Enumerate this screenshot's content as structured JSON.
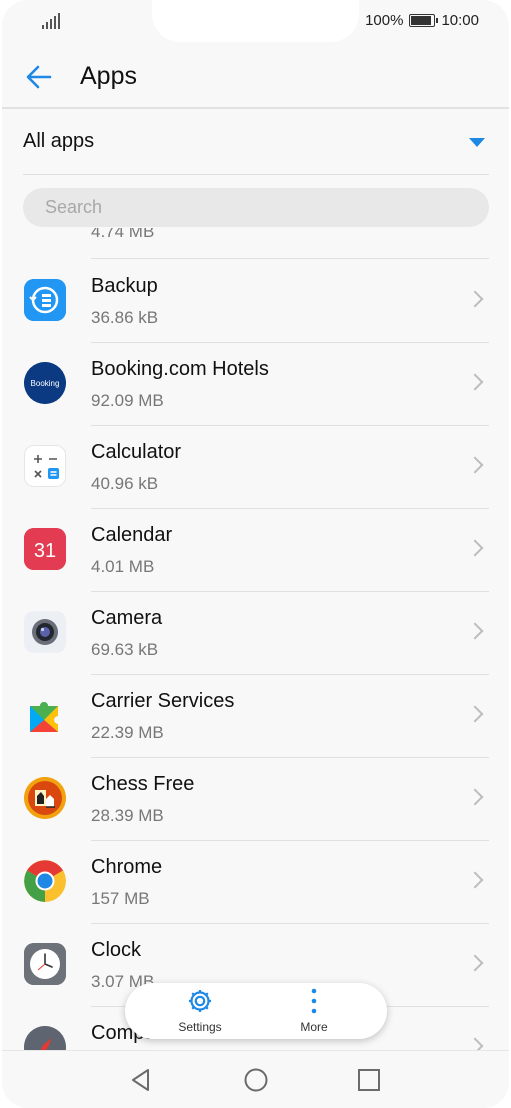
{
  "status_bar": {
    "battery": "100%",
    "time": "10:00"
  },
  "header": {
    "title": "Apps",
    "back_icon": "arrow-left-icon"
  },
  "filter": {
    "label": "All apps",
    "icon": "dropdown-triangle-icon"
  },
  "search": {
    "placeholder": "Search",
    "value": ""
  },
  "list": {
    "partial_size": "4.74 MB",
    "apps": [
      {
        "name": "Backup",
        "size": "36.86 kB",
        "icon": "backup-icon"
      },
      {
        "name": "Booking.com Hotels",
        "size": "92.09 MB",
        "icon": "booking-icon",
        "icon_text": "Booking"
      },
      {
        "name": "Calculator",
        "size": "40.96 kB",
        "icon": "calculator-icon"
      },
      {
        "name": "Calendar",
        "size": "4.01 MB",
        "icon": "calendar-icon",
        "icon_text": "31"
      },
      {
        "name": "Camera",
        "size": "69.63 kB",
        "icon": "camera-icon"
      },
      {
        "name": "Carrier Services",
        "size": "22.39 MB",
        "icon": "carrier-services-icon"
      },
      {
        "name": "Chess Free",
        "size": "28.39 MB",
        "icon": "chess-icon"
      },
      {
        "name": "Chrome",
        "size": "157 MB",
        "icon": "chrome-icon"
      },
      {
        "name": "Clock",
        "size": "3.07 MB",
        "icon": "clock-icon"
      },
      {
        "name": "Compass",
        "size": "",
        "icon": "compass-icon"
      }
    ]
  },
  "action_bar": {
    "settings_label": "Settings",
    "more_label": "More"
  },
  "nav_bar": {
    "back_icon": "nav-back-icon",
    "home_icon": "nav-home-icon",
    "recents_icon": "nav-recents-icon"
  },
  "colors": {
    "accent": "#1e88e5",
    "background": "#f8f8f8"
  }
}
